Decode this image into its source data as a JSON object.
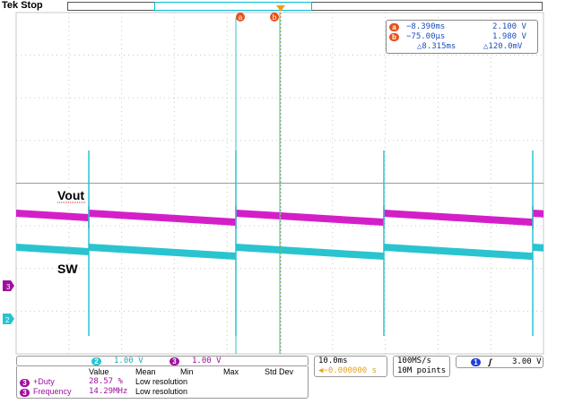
{
  "header": {
    "title": "Tek Stop"
  },
  "cursor_readout": {
    "a_label": "a",
    "a_time": "−8.390ms",
    "a_volt": "2.100 V",
    "b_label": "b",
    "b_time": "−75.00μs",
    "b_volt": "1.980 V",
    "delta_time": "△8.315ms",
    "delta_volt": "△120.0mV"
  },
  "cursor_markers": {
    "a": "a",
    "b": "b"
  },
  "traces": {
    "vout_label": "Vout",
    "sw_label": "SW",
    "ch2_marker": "2",
    "ch3_marker": "3"
  },
  "channels": {
    "ch2_num": "2",
    "ch2_scale": "1.00 V",
    "ch3_num": "3",
    "ch3_scale": "1.00 V"
  },
  "timebase": {
    "scale": "10.0ms",
    "trigger_pos": "◀−0.000000 s",
    "sample_rate": "100MS/s",
    "record": "10M points"
  },
  "trigger": {
    "channel": "1",
    "slope": "ʃ",
    "level": "3.00 V"
  },
  "measurements": {
    "headers": [
      "Value",
      "Mean",
      "Min",
      "Max",
      "Std Dev"
    ],
    "rows": [
      {
        "ch": "3",
        "name": "+Duty",
        "value": "28.57 %",
        "note": "Low resolution"
      },
      {
        "ch": "3",
        "name": "Frequency",
        "value": "14.29MHz",
        "note": "Low resolution"
      }
    ]
  },
  "colors": {
    "ch2_cyan": "#29c4cf",
    "ch3_magenta": "#d41fc9",
    "cursor_orange": "#e8501c",
    "grid": "#c8c8c8",
    "ch1_blue": "#1f3fd6"
  }
}
